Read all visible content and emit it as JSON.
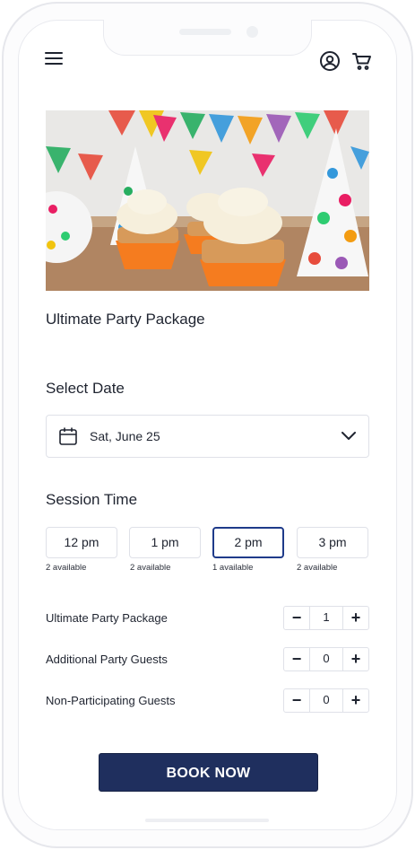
{
  "header": {
    "menu_icon": "hamburger-menu-icon",
    "account_icon": "user-circle-icon",
    "cart_icon": "shopping-cart-icon"
  },
  "product": {
    "title": "Ultimate Party Package"
  },
  "date": {
    "heading": "Select Date",
    "selected": "Sat, June 25",
    "icon": "calendar-icon"
  },
  "session": {
    "heading": "Session Time",
    "slots": [
      {
        "time": "12 pm",
        "availability": "2 available"
      },
      {
        "time": "1 pm",
        "availability": "2 available"
      },
      {
        "time": "2 pm",
        "availability": "1 available"
      },
      {
        "time": "3 pm",
        "availability": "2 available"
      }
    ],
    "selected_index": 2
  },
  "quantities": [
    {
      "label": "Ultimate Party Package",
      "value": "1"
    },
    {
      "label": "Additional Party Guests",
      "value": "0"
    },
    {
      "label": "Non-Participating Guests",
      "value": "0"
    }
  ],
  "stepper": {
    "minus": "−",
    "plus": "+"
  },
  "cta": {
    "label": "BOOK NOW"
  },
  "colors": {
    "accent": "#1f3b8a",
    "button_bg": "#1f2f5e",
    "border": "#dfe1e8"
  }
}
